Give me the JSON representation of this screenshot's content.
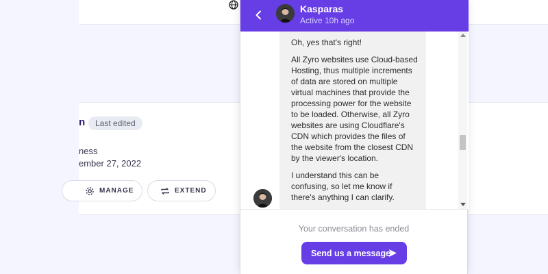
{
  "background": {
    "card": {
      "title_fragment": "n",
      "badge": "Last edited",
      "line1": "ness",
      "line2": "ember 27, 2022",
      "manage_label": "MANAGE",
      "extend_label": "EXTEND"
    }
  },
  "chat": {
    "agent_name": "Kasparas",
    "agent_status": "Active 10h ago",
    "messages": [
      "Oh, yes that's right!",
      "All Zyro websites use Cloud-based Hosting, thus multiple increments of data are stored on multiple virtual machines that provide the processing power for the website to be loaded. Otherwise, all Zyro websites are using Cloudflare's CDN which provides the files of the website from the closest CDN by the viewer's location.",
      "I understand this can be confusing, so let me know if there's anything I can clarify."
    ],
    "ended_text": "Your conversation has ended",
    "send_button_label": "Send us a message"
  },
  "colors": {
    "accent": "#673de6",
    "background": "#f4f5ff",
    "bubble": "#f1f1f1"
  }
}
